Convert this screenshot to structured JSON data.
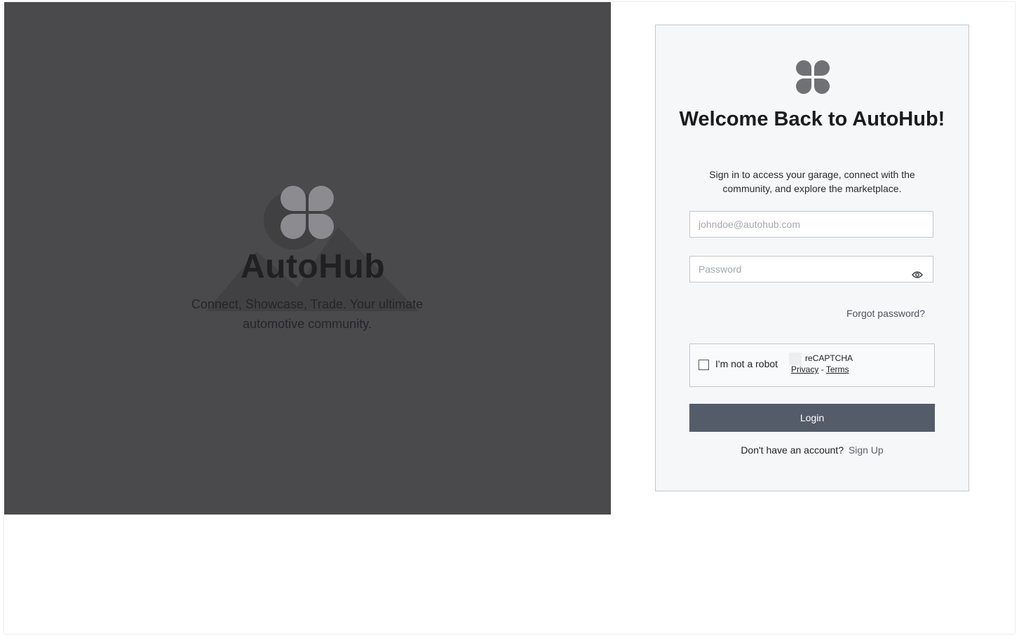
{
  "hero": {
    "title": "AutoHub",
    "tagline": "Connect, Showcase, Trade. Your ultimate automotive community.",
    "background_color": "#4a4a4d",
    "logo_icon": "clover-logo-icon"
  },
  "login_card": {
    "logo_icon": "clover-logo-icon",
    "title": "Welcome Back to AutoHub!",
    "subtitle": "Sign in to access your garage, connect with the community, and explore the marketplace.",
    "email": {
      "value": "",
      "placeholder": "johndoe@autohub.com"
    },
    "password": {
      "value": "",
      "placeholder": "Password",
      "toggle_icon": "eye-icon"
    },
    "forgot_password_label": "Forgot password?",
    "captcha": {
      "label": "I'm not a robot",
      "brand": "reCAPTCHA",
      "privacy_label": "Privacy",
      "separator": "-",
      "terms_label": "Terms",
      "checked": false
    },
    "login_label": "Login",
    "signup_prompt": "Don't have an account?",
    "signup_label": "Sign Up",
    "button_color": "#545c6a"
  }
}
